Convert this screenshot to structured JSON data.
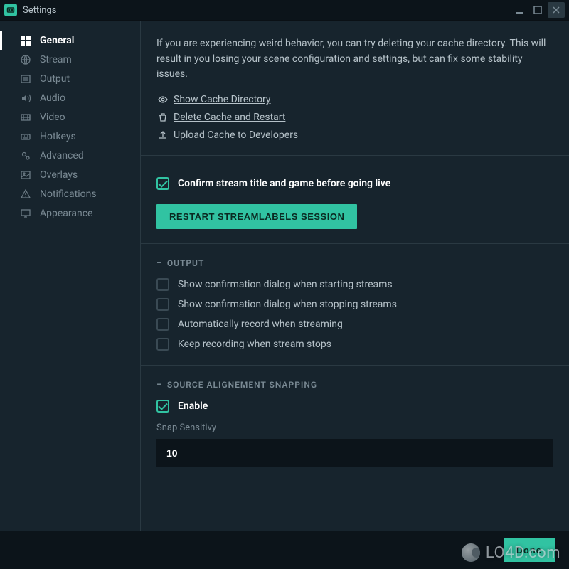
{
  "window_title": "Settings",
  "sidebar": {
    "items": [
      {
        "label": "General",
        "icon": "grid-icon",
        "active": true
      },
      {
        "label": "Stream",
        "icon": "globe-icon",
        "active": false
      },
      {
        "label": "Output",
        "icon": "output-icon",
        "active": false
      },
      {
        "label": "Audio",
        "icon": "audio-icon",
        "active": false
      },
      {
        "label": "Video",
        "icon": "video-icon",
        "active": false
      },
      {
        "label": "Hotkeys",
        "icon": "keyboard-icon",
        "active": false
      },
      {
        "label": "Advanced",
        "icon": "gears-icon",
        "active": false
      },
      {
        "label": "Overlays",
        "icon": "image-icon",
        "active": false
      },
      {
        "label": "Notifications",
        "icon": "warning-icon",
        "active": false
      },
      {
        "label": "Appearance",
        "icon": "monitor-icon",
        "active": false
      }
    ]
  },
  "cache_info_text": "If you are experiencing weird behavior, you can try deleting your cache directory. This will result in you losing your scene configuration and settings, but can fix some stability issues.",
  "cache_links": {
    "show": "Show Cache Directory",
    "delete": "Delete Cache and Restart",
    "upload": "Upload Cache to Developers"
  },
  "confirm_stream_label": "Confirm stream title and game before going live",
  "restart_button_label": "Restart Streamlabels Session",
  "output_section": {
    "title": "Output",
    "options": [
      "Show confirmation dialog when starting streams",
      "Show confirmation dialog when stopping streams",
      "Automatically record when streaming",
      "Keep recording when stream stops"
    ]
  },
  "snapping_section": {
    "title": "Source Alignement Snapping",
    "enable_label": "Enable",
    "sensitivity_label": "Snap Sensitivy",
    "sensitivity_value": "10"
  },
  "footer": {
    "done_label": "Done"
  },
  "watermark_text": "LO4D.com"
}
